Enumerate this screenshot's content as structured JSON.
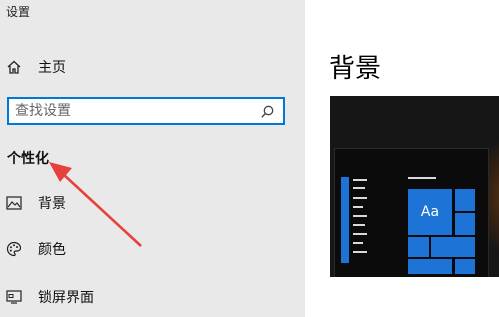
{
  "window": {
    "title": "设置"
  },
  "sidebar": {
    "home_label": "主页",
    "search_placeholder": "查找设置",
    "section_heading": "个性化",
    "items": [
      {
        "label": "背景",
        "icon": "image-icon"
      },
      {
        "label": "颜色",
        "icon": "palette-icon"
      },
      {
        "label": "锁屏界面",
        "icon": "lock-screen-icon"
      }
    ]
  },
  "main": {
    "title": "背景",
    "preview": {
      "tile_label": "Aa",
      "accent_color": "#1e74d6"
    }
  },
  "annotation": {
    "arrow_color": "#e8403a"
  }
}
